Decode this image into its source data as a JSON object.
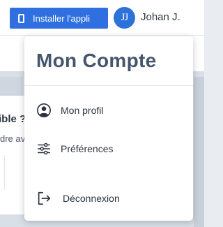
{
  "topbar": {
    "install_button_label": "Installer l'appli",
    "user_initials": "JJ",
    "user_name": "Johan J."
  },
  "background": {
    "card_title": "ible ?",
    "card_text": "dre av"
  },
  "menu": {
    "title": "Mon Compte",
    "items": [
      {
        "label": "Mon profil",
        "icon": "account-circle-icon"
      },
      {
        "label": "Préférences",
        "icon": "sliders-icon"
      },
      {
        "label": "Déconnexion",
        "icon": "logout-icon"
      }
    ]
  },
  "colors": {
    "accent": "#2f6fe0",
    "avatar": "#2d72d9",
    "menu_title": "#45566c"
  }
}
